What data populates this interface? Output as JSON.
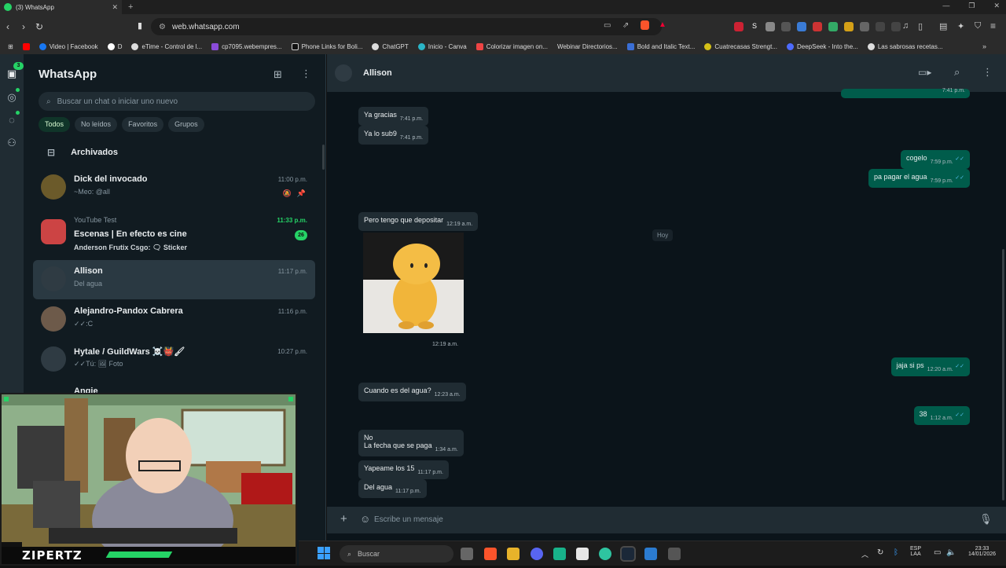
{
  "browser": {
    "tab_title": "(3) WhatsApp",
    "url": "web.whatsapp.com",
    "bookmarks": [
      "Video | Facebook",
      "D",
      "eTime - Control de l...",
      "cp7095.webempres...",
      "Phone Links for Boli...",
      "ChatGPT",
      "Inicio - Canva",
      "Colorizar imagen on...",
      "Webinar Directorios...",
      "Bold and Italic Text...",
      "Cuatrecasas Strengt...",
      "DeepSeek - Into the...",
      "Las sabrosas recetas..."
    ]
  },
  "rail": {
    "chats_badge": "3"
  },
  "sidebar": {
    "title": "WhatsApp",
    "search_placeholder": "Buscar un chat o iniciar uno nuevo",
    "filters": [
      "Todos",
      "No leídos",
      "Favoritos",
      "Grupos"
    ],
    "archived_label": "Archivados",
    "chats": [
      {
        "name": "Dick del invocado",
        "preview": "~Meo: @all",
        "time": "11:00 p.m."
      },
      {
        "group": "YouTube Test",
        "name": "Escenas | En efecto es cine",
        "preview": "Anderson Frutix Csgo: 🗨 Sticker",
        "time": "11:33 p.m.",
        "unread": "26"
      },
      {
        "name": "Allison",
        "preview": "Del agua",
        "time": "11:17 p.m."
      },
      {
        "name": "Alejandro-Pandox Cabrera",
        "preview": "✓✓:C",
        "time": "11:16 p.m."
      },
      {
        "name": "Hytale / GuildWars ☠️👹🖌",
        "preview": "✓✓Tú: 🖼 Foto",
        "time": "10:27 p.m."
      },
      {
        "name": "Angie"
      }
    ]
  },
  "webcam": {
    "caption": "ZIPERTZ"
  },
  "chat": {
    "contact": "Allison",
    "day_separator": "Hoy",
    "messages": [
      {
        "dir": "in",
        "text": "Ya gracias",
        "time": "7:41 p.m."
      },
      {
        "dir": "in",
        "text": "Ya lo sub9",
        "time": "7:41 p.m."
      },
      {
        "dir": "out",
        "text": "",
        "time": "7:41 p.m."
      },
      {
        "dir": "out",
        "text": "cogelo",
        "time": "7:59 p.m."
      },
      {
        "dir": "out",
        "text": "pa pagar el agua",
        "time": "7:59 p.m."
      },
      {
        "dir": "in",
        "text": "Pero tengo que depositar",
        "time": "12:19 a.m."
      },
      {
        "dir": "in",
        "text": "",
        "time": "12:19 a.m."
      },
      {
        "dir": "out",
        "text": "jaja si ps",
        "time": "12:20 a.m."
      },
      {
        "dir": "in",
        "text": "Cuando es del agua?",
        "time": "12:23 a.m."
      },
      {
        "dir": "out",
        "text": "38",
        "time": "1:12 a.m."
      },
      {
        "dir": "in",
        "text": "No",
        "time": ""
      },
      {
        "dir": "in",
        "text": "La fecha que se paga",
        "time": "1:34 a.m."
      },
      {
        "dir": "in",
        "text": "Yapeame los 15",
        "time": "11:17 p.m."
      },
      {
        "dir": "in",
        "text": "Del agua",
        "time": "11:17 p.m."
      }
    ],
    "composer_placeholder": "Escribe un mensaje"
  },
  "taskbar": {
    "search_placeholder": "Buscar",
    "lang": "ESP",
    "lang2": "LAA",
    "time": "23:33",
    "date": "14/01/2026"
  }
}
